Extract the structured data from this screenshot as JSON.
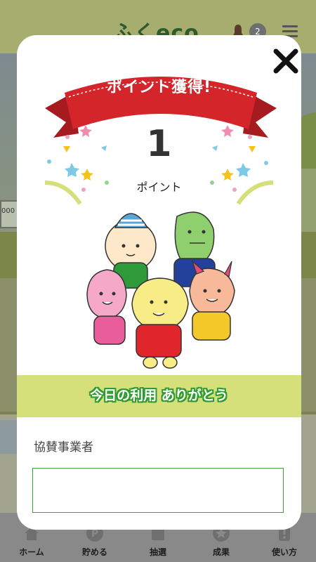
{
  "header": {
    "logo_text": "ふくeco",
    "notification_count": "2",
    "icons": [
      "bell-icon",
      "menu-icon"
    ]
  },
  "background": {
    "board_text": "000"
  },
  "bottom_nav": {
    "items": [
      {
        "label": "ホーム",
        "icon": "home-icon"
      },
      {
        "label": "貯める",
        "icon": "point-coin-icon"
      },
      {
        "label": "抽選",
        "icon": "lottery-icon"
      },
      {
        "label": "成果",
        "icon": "star-medal-icon"
      },
      {
        "label": "使い方",
        "icon": "guide-icon"
      }
    ]
  },
  "modal": {
    "ribbon_title": "ポイント獲得!",
    "points_value": "1",
    "points_unit": "ポイント",
    "thanks_text": "今日の利用 ありがとう",
    "sponsor_label": "協賛事業者",
    "sponsor_value": "",
    "close_icon": "close-icon"
  },
  "colors": {
    "ribbon_red": "#d4252a",
    "thanks_band": "#d5e07a",
    "thanks_outline": "#2e9c2e",
    "sponsor_border": "#39a339"
  }
}
